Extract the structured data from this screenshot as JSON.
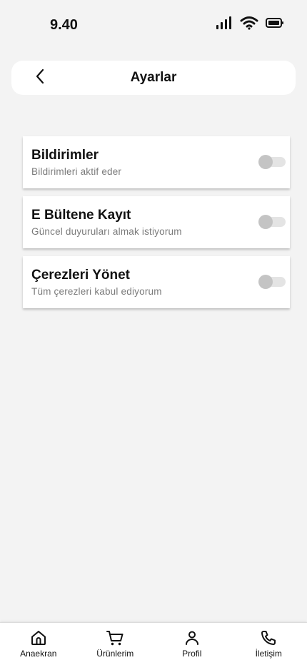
{
  "status_bar": {
    "time": "9.40",
    "icons": [
      "signal-icon",
      "wifi-icon",
      "battery-icon"
    ]
  },
  "header": {
    "title": "Ayarlar",
    "back_icon": "chevron-left-icon"
  },
  "settings": [
    {
      "title": "Bildirimler",
      "subtitle": "Bildirimleri aktif eder",
      "enabled": false
    },
    {
      "title": "E Bültene Kayıt",
      "subtitle": "Güncel duyuruları almak istiyorum",
      "enabled": false
    },
    {
      "title": "Çerezleri Yönet",
      "subtitle": "Tüm çerezleri kabul ediyorum",
      "enabled": false
    }
  ],
  "bottom_nav": {
    "items": [
      {
        "label": "Anaekran",
        "icon": "home-icon"
      },
      {
        "label": "Ürünlerim",
        "icon": "cart-icon"
      },
      {
        "label": "Profil",
        "icon": "user-icon"
      },
      {
        "label": "İletişim",
        "icon": "phone-icon"
      }
    ]
  },
  "colors": {
    "background": "#f3f3f3",
    "card": "#ffffff",
    "toggle_off_track": "#e4e4e4",
    "toggle_off_knob": "#c4c4c4",
    "subtitle": "#7a7a7a"
  }
}
